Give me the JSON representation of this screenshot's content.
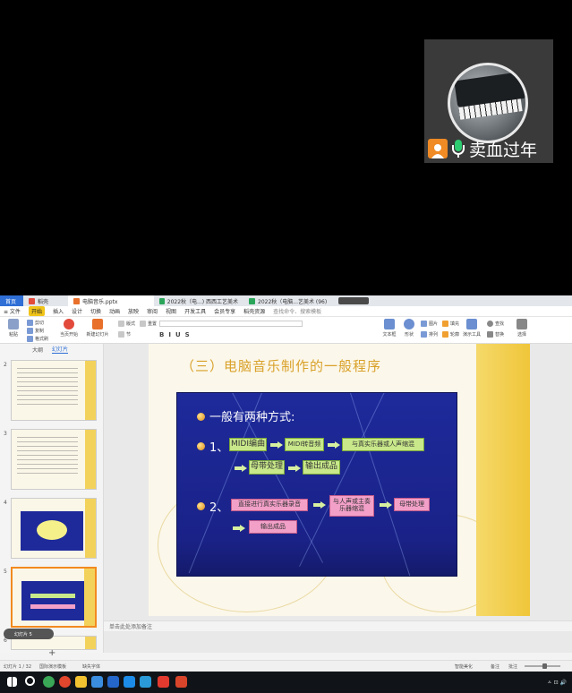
{
  "overlay": {
    "user_name": "卖血过年"
  },
  "tabs": [
    {
      "label": "首页"
    },
    {
      "label": "稻壳"
    },
    {
      "label": "电脑音乐.pptx"
    },
    {
      "label": "2022秋（电...) 西西工艺美术"
    },
    {
      "label": "2022秋（电脑...艺美术 (96)"
    }
  ],
  "menu": [
    "≡ 文件",
    "开始",
    "插入",
    "设计",
    "切换",
    "动画",
    "放映",
    "审阅",
    "视图",
    "开发工具",
    "会员专享",
    "稻壳资源",
    "查找命令、搜索模板"
  ],
  "menu_active_index": 1,
  "ribbon": {
    "paste": "粘贴",
    "cut": "剪切",
    "copy": "复制",
    "format_painter": "格式刷",
    "play_from_current": "当页开始",
    "new_slide": "新建幻灯片",
    "layout": "版式",
    "section": "节",
    "reset": "重置",
    "textbox": "文本框",
    "shape": "形状",
    "arrange": "排列",
    "picture": "图片",
    "fill": "填充",
    "outline": "轮廓",
    "find": "查找",
    "replace": "替换",
    "select": "选择",
    "present_tools": "演示工具"
  },
  "left_panel": {
    "tab_outline": "大纲",
    "tab_slides": "幻灯片",
    "thumb_numbers": [
      "2",
      "3",
      "4",
      "5",
      "6"
    ],
    "tip": "幻灯片 5"
  },
  "slide": {
    "title": "（三）电脑音乐制作的一般程序",
    "heading": "一般有两种方式:",
    "way1_num": "1、",
    "way1_steps": [
      "MIDI编曲",
      "MIDI转音频",
      "与真实乐器或人声缩混",
      "母带处理",
      "输出成品"
    ],
    "way2_num": "2、",
    "way2_steps": [
      "直接进行真实乐器录音",
      "与人声或主奏乐器缩混",
      "母带处理",
      "输出成品"
    ]
  },
  "notes_placeholder": "单击此处添加备注",
  "status": {
    "slide_info": "幻灯片 1 / 32",
    "theme": "国际演示模板",
    "font_warning": "缺失字体",
    "smart_beautify": "智能美化",
    "notes": "备注",
    "comments": "批注"
  },
  "colors": {
    "accent": "#2f6fd6",
    "title": "#d9a12a",
    "board": "#1e2a9b",
    "green_box": "#c8e88a",
    "pink_box": "#f2a0c8",
    "stripe": "#f0c63a"
  }
}
